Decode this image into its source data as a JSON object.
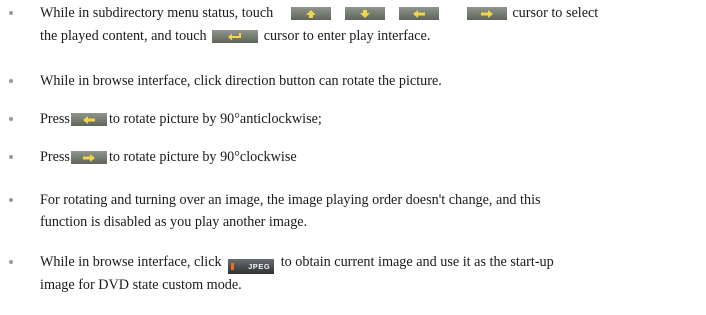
{
  "items": [
    {
      "line1": {
        "a": "While in subdirectory menu status, touch",
        "b": "cursor to select"
      },
      "line2": {
        "a": "the played content, and touch",
        "b": "cursor to enter play interface."
      }
    },
    {
      "text": "While in browse interface, click direction button can rotate the picture."
    },
    {
      "a": "Press",
      "b": "to rotate picture by 90°anticlockwise;"
    },
    {
      "a": "Press",
      "b": "to rotate picture by 90°clockwise"
    },
    {
      "line1": "For rotating and turning over an image, the image playing order doesn't change, and this",
      "line2": "function is disabled as you play another image."
    },
    {
      "line1": {
        "a": "While in browse interface, click",
        "b": "to obtain current image and use it as the start-up"
      },
      "line2": "image for DVD state custom mode."
    }
  ],
  "icons": {
    "jpeg_label": "JPEG",
    "key_up": "arrow-up-key-icon",
    "key_down": "arrow-down-key-icon",
    "key_left": "arrow-left-key-icon",
    "key_right": "arrow-right-key-icon",
    "key_enter": "enter-key-icon",
    "arrow_color": "#f2d44c",
    "key_color": "#6f766b",
    "jpeg_accent": "#e8731a"
  }
}
